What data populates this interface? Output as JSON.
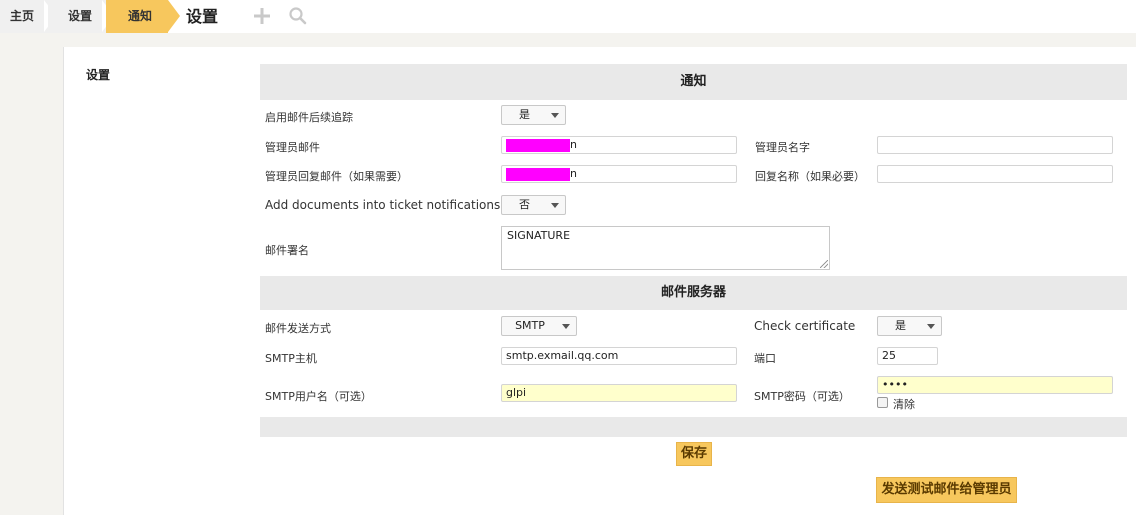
{
  "breadcrumb": {
    "home": "主页",
    "setup": "设置",
    "current": "通知"
  },
  "page_title": "设置",
  "colors": {
    "accent": "#f7c75d",
    "header_bg": "#e9e9e9",
    "redaction": "#ff00ff",
    "autofill": "#ffffcc"
  },
  "icons": {
    "add": "plus-icon",
    "search": "search-icon"
  },
  "sidebar": {
    "title": "设置"
  },
  "notifications_section": {
    "title": "通知",
    "followup_label": "启用邮件后续追踪",
    "followup_value": "是",
    "admin_email_label": "管理员邮件",
    "admin_email_tail": "n",
    "admin_name_label": "管理员名字",
    "admin_name_value": "",
    "reply_email_label": "管理员回复邮件（如果需要）",
    "reply_email_tail": "n",
    "reply_name_label": "回复名称（如果必要）",
    "reply_name_value": "",
    "add_docs_label": "Add documents into ticket notifications",
    "add_docs_value": "否",
    "signature_label": "邮件署名",
    "signature_value": "SIGNATURE"
  },
  "mail_server_section": {
    "title": "邮件服务器",
    "method_label": "邮件发送方式",
    "method_value": "SMTP",
    "check_cert_label": "Check certificate",
    "check_cert_value": "是",
    "host_label": "SMTP主机",
    "host_value": "smtp.exmail.qq.com",
    "port_label": "端口",
    "port_value": "25",
    "user_label": "SMTP用户名（可选）",
    "user_value": "glpi",
    "password_label": "SMTP密码（可选）",
    "password_value": "••••",
    "clear_label": "清除"
  },
  "buttons": {
    "save": "保存",
    "send_test": "发送测试邮件给管理员"
  }
}
